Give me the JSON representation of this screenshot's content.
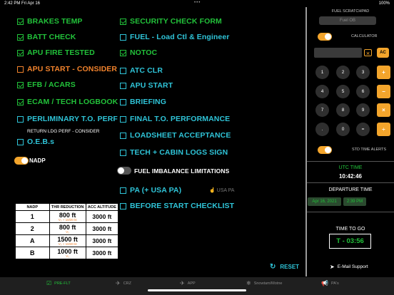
{
  "statusbar": {
    "time": "2:42 PM",
    "date": "Fri Apr 16",
    "dots": "•••",
    "right": "100%"
  },
  "checklist_left": [
    {
      "label": "BRAKES TEMP",
      "checked": true,
      "color": "green"
    },
    {
      "label": "BATT CHECK",
      "checked": true,
      "color": "green"
    },
    {
      "label": "APU FIRE TESTED",
      "checked": true,
      "color": "green"
    },
    {
      "label": "APU START - CONSIDER",
      "checked": false,
      "color": "orange"
    },
    {
      "label": "EFB / ACARS",
      "checked": true,
      "color": "green"
    },
    {
      "label": "ECAM / TECH LOGBOOK",
      "checked": true,
      "color": "green"
    },
    {
      "label": "PERLIMINARY T.O. PERF",
      "checked": false,
      "color": "cyan"
    },
    {
      "label": "O.E.B.s",
      "checked": false,
      "color": "cyan"
    }
  ],
  "return_ldg_note": "RETURN LDG PERF - CONSIDER",
  "checklist_right": [
    {
      "label": "SECURITY CHECK FORM",
      "checked": true,
      "color": "green"
    },
    {
      "label": "FUEL - Load Ctl & Engineer",
      "checked": false,
      "color": "cyan"
    },
    {
      "label": "NOTOC",
      "checked": true,
      "color": "green"
    },
    {
      "label": "ATC CLR",
      "checked": false,
      "color": "cyan"
    },
    {
      "label": "APU START",
      "checked": false,
      "color": "cyan"
    },
    {
      "label": "BRIEFING",
      "checked": false,
      "color": "cyan"
    },
    {
      "label": "FINAL T.O. PERFORMANCE",
      "checked": false,
      "color": "cyan"
    },
    {
      "label": "LOADSHEET ACCEPTANCE",
      "checked": false,
      "color": "cyan"
    },
    {
      "label": "TECH + CABIN LOGS SIGN",
      "checked": false,
      "color": "cyan"
    }
  ],
  "pa_item": {
    "label": "PA (+ USA PA)",
    "checked": false
  },
  "before_start": {
    "label": "BEFORE START CHECKLIST",
    "checked": false
  },
  "usa_pa": "USA PA",
  "nadp_toggle": {
    "label": "NADP",
    "on": true
  },
  "fuel_imbalance": {
    "label": "FUEL IMBALANCE  LIMITATIONS",
    "on": false
  },
  "nadp_table": {
    "headers": [
      "NADP",
      "THR REDUCTION",
      "ACC ALTITUDE"
    ],
    "rows": [
      {
        "id": "1",
        "thr": "800 ft",
        "sub": "V₂ + 10/20 kt",
        "alt": "3000 ft"
      },
      {
        "id": "2",
        "thr": "800 ft",
        "sub": "V₂",
        "alt": "3000 ft"
      },
      {
        "id": "A",
        "thr": "1500 ft",
        "sub": "V₂ + 10/20 kt",
        "alt": "3000 ft"
      },
      {
        "id": "B",
        "thr": "1000 ft",
        "sub": "V₂",
        "alt": "3000 ft"
      }
    ]
  },
  "reset": {
    "label": "RESET",
    "icon": "refresh-icon"
  },
  "fuel_scratchpad": {
    "title": "FUEL SCRATCHPAD",
    "placeholder": "Fuel OB"
  },
  "calculator": {
    "label": "CALCULATOR",
    "toggle_on": true,
    "clear_icon": "backspace-icon",
    "ac_label": "AC",
    "rows": [
      [
        "1",
        "2",
        "3",
        "+"
      ],
      [
        "4",
        "5",
        "6",
        "−"
      ],
      [
        "7",
        "8",
        "9",
        "×"
      ],
      [
        ".",
        "0",
        "=",
        "÷"
      ]
    ]
  },
  "std_time_alerts": {
    "label": "STD TIME ALERTS",
    "on": true
  },
  "utc": {
    "label": "UTC TIME",
    "time": "10:42:46"
  },
  "departure": {
    "label": "DEPARTURE TIME",
    "date": "Apr 16, 2021",
    "time": "2:39 PM"
  },
  "time_to_go": {
    "label": "TIME TO GO",
    "value": "T - 03:56"
  },
  "email_support": {
    "label": "E-Mail Support",
    "icon": "send-icon"
  },
  "tabs": [
    {
      "label": "PRE-FLT",
      "icon": "checklist-icon",
      "active": true
    },
    {
      "label": "CRZ",
      "icon": "plane-icon",
      "active": false
    },
    {
      "label": "APP",
      "icon": "landing-icon",
      "active": false
    },
    {
      "label": "Snowtam/Motne",
      "icon": "snowflake-icon",
      "active": false
    },
    {
      "label": "PA's",
      "icon": "megaphone-icon",
      "active": false
    }
  ],
  "colors": {
    "green": "#22c23a",
    "cyan": "#2fc4d8",
    "orange": "#f0822c",
    "amber": "#f3a52c"
  }
}
